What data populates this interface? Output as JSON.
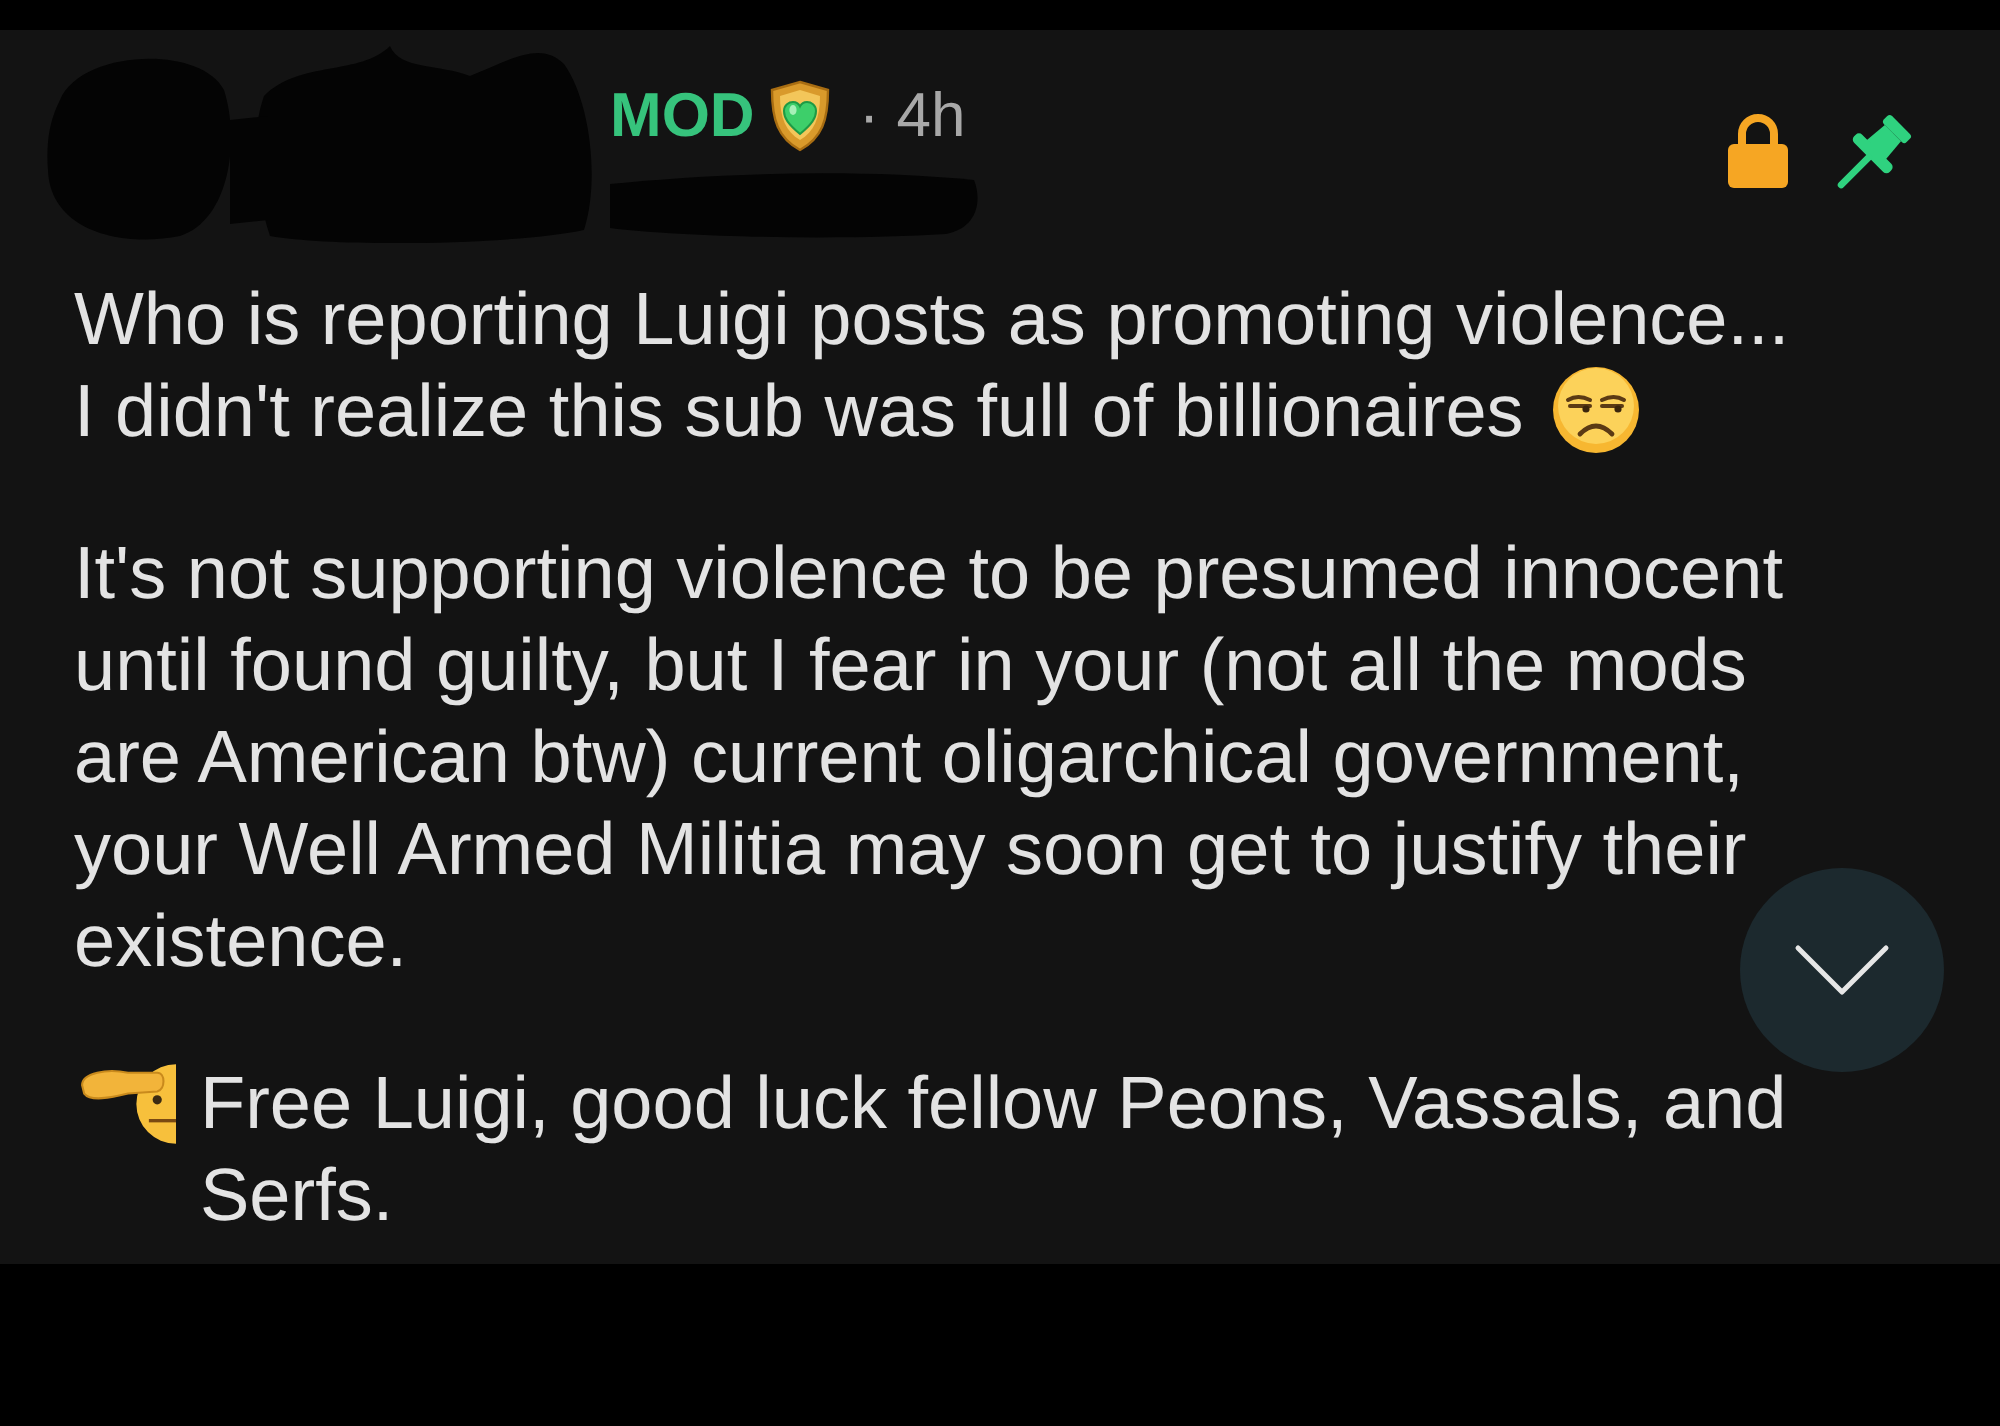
{
  "post": {
    "badge": "MOD",
    "time": "· 4h",
    "locked": true,
    "pinned": true,
    "paragraphs": [
      {
        "parts": [
          {
            "kind": "plain",
            "text": "Who is reporting Luigi posts as promoting violence..."
          },
          {
            "kind": "emoji-after",
            "text": "I didn't realize this sub was full of billionaires"
          }
        ]
      },
      {
        "parts": [
          {
            "kind": "plain",
            "text": "It's not supporting violence to be presumed innocent until found guilty, but I fear in your (not all the mods are American btw) current oligarchical government, your Well Armed Militia may soon get to justify their existence."
          }
        ]
      },
      {
        "parts": [
          {
            "kind": "emoji-before",
            "text": "Free Luigi, good luck fellow Peons, Vassals, and Serfs."
          }
        ]
      }
    ]
  }
}
